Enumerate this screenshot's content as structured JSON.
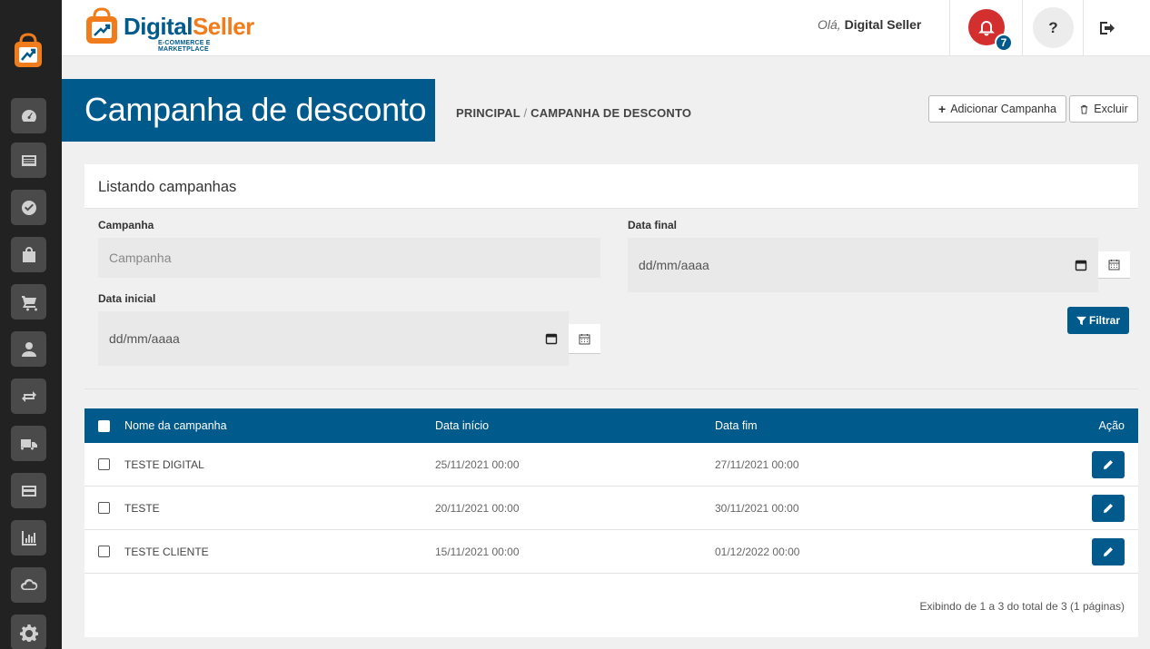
{
  "brand": {
    "name_part1": "Digital",
    "name_part2": "Seller",
    "tagline": "E-COMMERCE E MARKETPLACE"
  },
  "header": {
    "greeting": "Olá,",
    "user_name": "Digital Seller",
    "notifications_count": "7",
    "help_label": "?"
  },
  "page": {
    "title": "Campanha de desconto",
    "breadcrumb_root": "PRINCIPAL",
    "breadcrumb_sep": "/",
    "breadcrumb_current": "CAMPANHA DE DESCONTO",
    "add_button": "Adicionar Campanha",
    "add_icon": "+",
    "delete_button": "Excluir"
  },
  "filters": {
    "panel_title": "Listando campanhas",
    "campaign_label": "Campanha",
    "campaign_placeholder": "Campanha",
    "start_label": "Data inicial",
    "start_value": "dd/mm/aaaa",
    "end_label": "Data final",
    "end_value": "dd/mm/aaaa",
    "filter_button": "Filtrar"
  },
  "table": {
    "columns": [
      "Nome da campanha",
      "Data início",
      "Data fim",
      "Ação"
    ],
    "rows": [
      {
        "name": "TESTE DIGITAL",
        "start": "25/11/2021 00:00",
        "end": "27/11/2021 00:00"
      },
      {
        "name": "TESTE",
        "start": "20/11/2021 00:00",
        "end": "30/11/2021 00:00"
      },
      {
        "name": "TESTE CLIENTE",
        "start": "15/11/2021 00:00",
        "end": "01/12/2022 00:00"
      }
    ],
    "pagination_info": "Exibindo de 1 a 3 do total de 3 (1 páginas)"
  },
  "colors": {
    "primary": "#005a8c",
    "accent_orange": "#f07c1c",
    "alert_red": "#d32f2f",
    "sidebar_bg": "#222222"
  },
  "sidebar_icons": [
    "dashboard-icon",
    "list-icon",
    "check-circle-icon",
    "bag-icon",
    "cart-icon",
    "user-icon",
    "exchange-icon",
    "truck-icon",
    "credit-card-icon",
    "bar-chart-icon",
    "cloud-icon",
    "gear-icon"
  ]
}
